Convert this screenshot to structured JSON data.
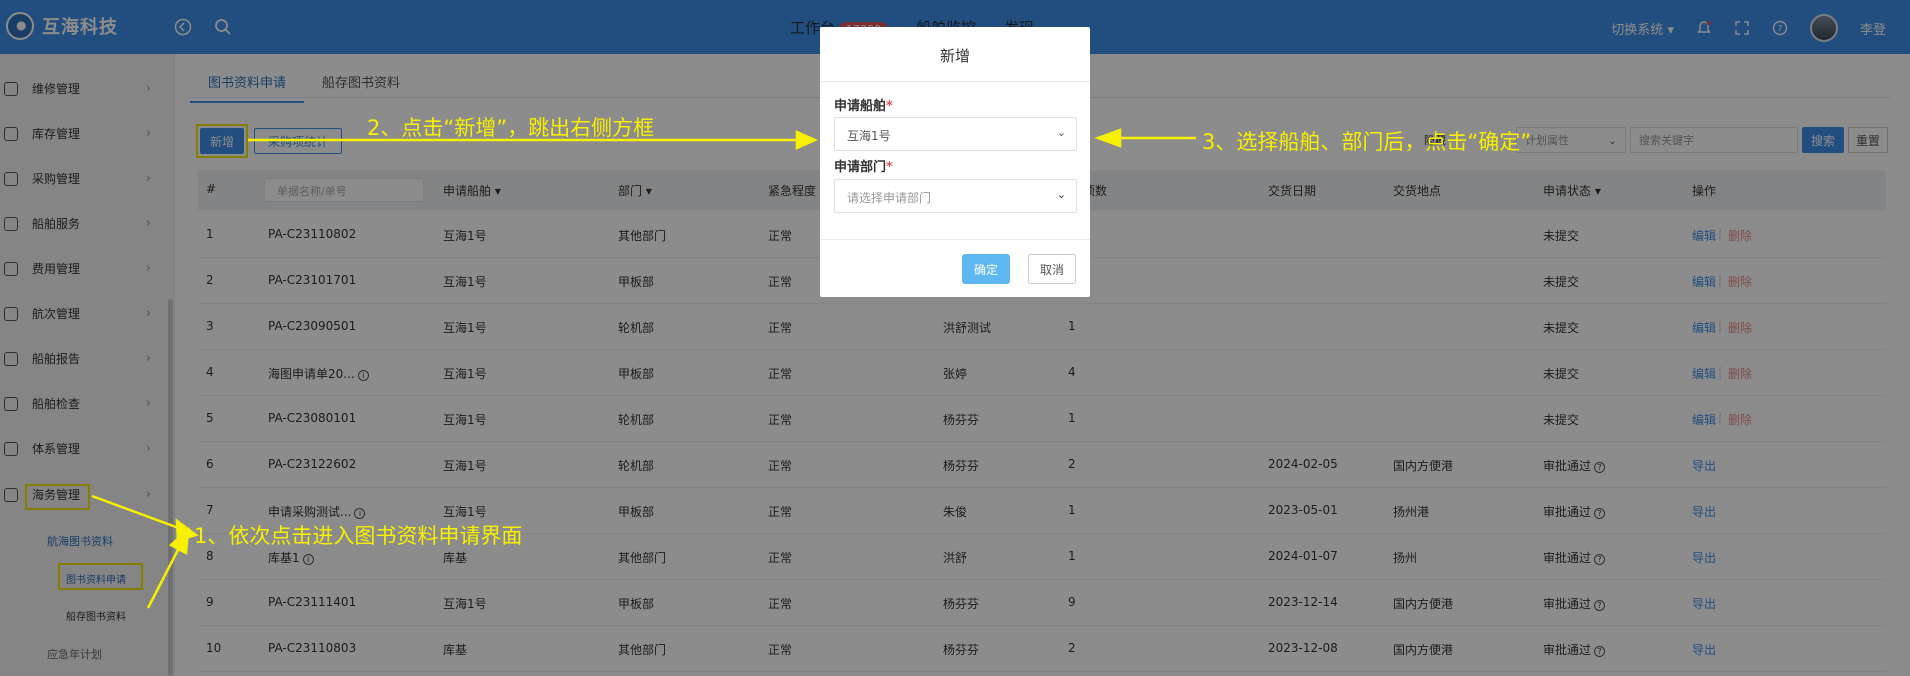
{
  "header": {
    "app_name": "互海科技",
    "menu": [
      {
        "label": "工作台",
        "badge": "17380"
      },
      {
        "label": "船舶监控"
      },
      {
        "label": "发现"
      }
    ],
    "switch_system": "切换系统",
    "user_name": "李登"
  },
  "sidebar": {
    "items": [
      {
        "label": "维修管理",
        "icon": "wrench-icon"
      },
      {
        "label": "库存管理",
        "icon": "warehouse-icon"
      },
      {
        "label": "采购管理",
        "icon": "cart-icon"
      },
      {
        "label": "船舶服务",
        "icon": "service-icon"
      },
      {
        "label": "费用管理",
        "icon": "database-icon"
      },
      {
        "label": "航次管理",
        "icon": "voyage-icon"
      },
      {
        "label": "船舶报告",
        "icon": "report-icon"
      },
      {
        "label": "船舶检查",
        "icon": "check-icon"
      },
      {
        "label": "体系管理",
        "icon": "document-icon"
      },
      {
        "label": "海务管理",
        "icon": "flag-icon"
      }
    ],
    "sub_items": [
      "航海图书资料",
      "图书资料申请",
      "船存图书资料",
      "应急年计划"
    ]
  },
  "tabs": [
    "图书资料申请",
    "船存图书资料"
  ],
  "toolbar": {
    "add_label": "新增",
    "stats_label": "采购项统计",
    "hide_label": "隐藏",
    "plan_attr_placeholder": "计划属性",
    "keyword_placeholder": "搜索关键字",
    "search_label": "搜索",
    "reset_label": "重置"
  },
  "table": {
    "headers": [
      "#",
      "申请船舶",
      "部门",
      "紧急程度",
      "项数",
      "交货日期",
      "交货地点",
      "申请状态",
      "操作"
    ],
    "filter_placeholder": "单据名称/单号",
    "rows": [
      {
        "no": "1",
        "doc": "PA-C23110802",
        "ship": "互海1号",
        "dept": "其他部门",
        "urgency": "正常",
        "applicant": "",
        "count": "",
        "date": "",
        "place": "",
        "status": "未提交",
        "actions": [
          "编辑",
          "删除"
        ]
      },
      {
        "no": "2",
        "doc": "PA-C23101701",
        "ship": "互海1号",
        "dept": "甲板部",
        "urgency": "正常",
        "applicant": "",
        "count": "",
        "date": "",
        "place": "",
        "status": "未提交",
        "actions": [
          "编辑",
          "删除"
        ]
      },
      {
        "no": "3",
        "doc": "PA-C23090501",
        "ship": "互海1号",
        "dept": "轮机部",
        "urgency": "正常",
        "applicant": "洪舒测试",
        "count": "1",
        "date": "",
        "place": "",
        "status": "未提交",
        "actions": [
          "编辑",
          "删除"
        ]
      },
      {
        "no": "4",
        "doc": "海图申请单20...",
        "ship": "互海1号",
        "dept": "甲板部",
        "urgency": "正常",
        "applicant": "张婷",
        "count": "4",
        "date": "",
        "place": "",
        "status": "未提交",
        "actions": [
          "编辑",
          "删除"
        ]
      },
      {
        "no": "5",
        "doc": "PA-C23080101",
        "ship": "互海1号",
        "dept": "轮机部",
        "urgency": "正常",
        "applicant": "杨芬芬",
        "count": "1",
        "date": "",
        "place": "",
        "status": "未提交",
        "actions": [
          "编辑",
          "删除"
        ]
      },
      {
        "no": "6",
        "doc": "PA-C23122602",
        "ship": "互海1号",
        "dept": "轮机部",
        "urgency": "正常",
        "applicant": "杨芬芬",
        "count": "2",
        "date": "2024-02-05",
        "place": "国内方便港",
        "status": "审批通过",
        "actions": [
          "导出"
        ]
      },
      {
        "no": "7",
        "doc": "申请采购测试...",
        "ship": "互海1号",
        "dept": "甲板部",
        "urgency": "正常",
        "applicant": "朱俊",
        "count": "1",
        "date": "2023-05-01",
        "place": "扬州港",
        "status": "审批通过",
        "actions": [
          "导出"
        ]
      },
      {
        "no": "8",
        "doc": "库基1",
        "ship": "库基",
        "dept": "其他部门",
        "urgency": "正常",
        "applicant": "洪舒",
        "count": "1",
        "date": "2024-01-07",
        "place": "扬州",
        "status": "审批通过",
        "actions": [
          "导出"
        ]
      },
      {
        "no": "9",
        "doc": "PA-C23111401",
        "ship": "互海1号",
        "dept": "甲板部",
        "urgency": "正常",
        "applicant": "杨芬芬",
        "count": "9",
        "date": "2023-12-14",
        "place": "国内方便港",
        "status": "审批通过",
        "actions": [
          "导出"
        ]
      },
      {
        "no": "10",
        "doc": "PA-C23110803",
        "ship": "库基",
        "dept": "其他部门",
        "urgency": "正常",
        "applicant": "杨芬芬",
        "count": "2",
        "date": "2023-12-08",
        "place": "国内方便港",
        "status": "审批通过",
        "actions": [
          "导出"
        ]
      }
    ]
  },
  "dialog": {
    "title": "新增",
    "ship_label": "申请船舶",
    "ship_value": "互海1号",
    "dept_label": "申请部门",
    "dept_placeholder": "请选择申请部门",
    "confirm_label": "确定",
    "cancel_label": "取消"
  },
  "annotations": {
    "step1": "1、依次点击进入图书资料申请界面",
    "step2": "2、点击“新增”，跳出右侧方框",
    "step3": "3、选择船舶、部门后，点击“确定”"
  }
}
